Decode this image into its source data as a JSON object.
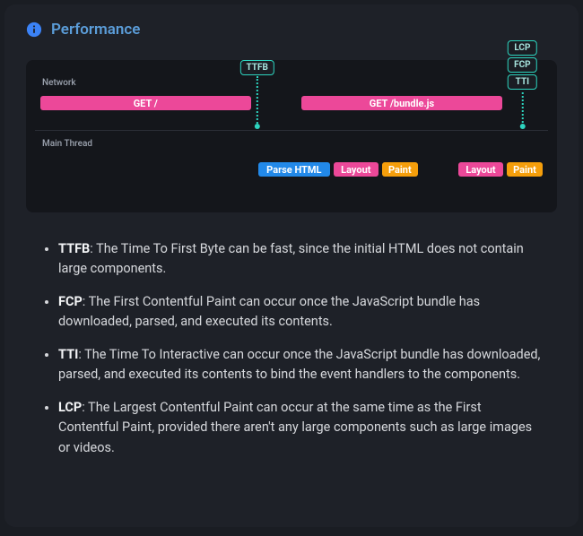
{
  "header": {
    "title": "Performance"
  },
  "timeline": {
    "rows": {
      "network": "Network",
      "mainThread": "Main Thread"
    },
    "markers": {
      "ttfb": "TTFB",
      "lcp": "LCP",
      "fcp": "FCP",
      "tti": "TTI"
    },
    "bars": {
      "getRoot": "GET /",
      "getBundle": "GET /bundle.js",
      "parseHtml": "Parse HTML",
      "layout1": "Layout",
      "paint1": "Paint",
      "layout2": "Layout",
      "paint2": "Paint"
    }
  },
  "metrics": [
    {
      "term": "TTFB",
      "text": ": The Time To First Byte can be fast, since the initial HTML does not contain large components."
    },
    {
      "term": "FCP",
      "text": ": The First Contentful Paint can occur once the JavaScript bundle has downloaded, parsed, and executed its contents."
    },
    {
      "term": "TTI",
      "text": ": The Time To Interactive can occur once the JavaScript bundle has downloaded, parsed, and executed its contents to bind the event handlers to the components."
    },
    {
      "term": "LCP",
      "text": ": The Largest Contentful Paint can occur at the same time as the First Contentful Paint, provided there aren't any large components such as large images or videos."
    }
  ]
}
